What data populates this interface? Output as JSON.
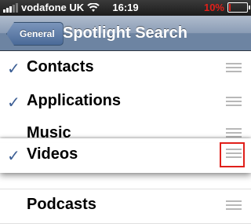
{
  "status_bar": {
    "carrier": "vodafone UK",
    "time": "16:19",
    "battery_text": "10%",
    "battery_level": 0.1,
    "signal_bars": 3,
    "wifi_icon": "wifi-icon"
  },
  "nav": {
    "back_label": "General",
    "title": "Spotlight Search"
  },
  "items": [
    {
      "label": "Contacts",
      "checked": true
    },
    {
      "label": "Applications",
      "checked": true
    },
    {
      "label": "Music",
      "checked": false
    },
    {
      "label": "Videos",
      "checked": true,
      "dragging": true
    },
    {
      "label": "Podcasts",
      "checked": false
    }
  ],
  "check_glyph": "✓",
  "accent_color": "#3d5f95",
  "highlight_color": "#e0201a"
}
